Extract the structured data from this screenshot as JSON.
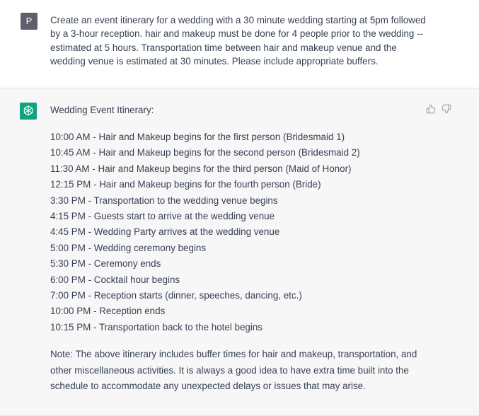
{
  "user_message": {
    "avatar_letter": "P",
    "text": "Create an event itinerary for a wedding with a 30 minute wedding starting at 5pm followed by a 3-hour reception. hair and makeup must be done for 4 people prior to the wedding -- estimated at 5 hours. Transportation time between hair and makeup venue and the wedding venue is estimated at 30 minutes. Please include appropriate buffers."
  },
  "assistant_message": {
    "avatar_icon": "openai-logo-icon",
    "heading": "Wedding Event Itinerary:",
    "itinerary": [
      "10:00 AM - Hair and Makeup begins for the first person (Bridesmaid 1)",
      "10:45 AM - Hair and Makeup begins for the second person (Bridesmaid 2)",
      "11:30 AM - Hair and Makeup begins for the third person (Maid of Honor)",
      "12:15 PM - Hair and Makeup begins for the fourth person (Bride)",
      "3:30 PM - Transportation to the wedding venue begins",
      "4:15 PM - Guests start to arrive at the wedding venue",
      "4:45 PM - Wedding Party arrives at the wedding venue",
      "5:00 PM - Wedding ceremony begins",
      "5:30 PM - Ceremony ends",
      "6:00 PM - Cocktail hour begins",
      "7:00 PM - Reception starts (dinner, speeches, dancing, etc.)",
      "10:00 PM - Reception ends",
      "10:15 PM - Transportation back to the hotel begins"
    ],
    "note": "Note: The above itinerary includes buffer times for hair and makeup, transportation, and other miscellaneous activities. It is always a good idea to have extra time built into the schedule to accommodate any unexpected delays or issues that may arise."
  },
  "feedback": {
    "thumbs_up_icon": "thumbs-up-icon",
    "thumbs_down_icon": "thumbs-down-icon"
  },
  "colors": {
    "assistant_avatar_bg": "#10a37f",
    "user_avatar_bg": "#5e5e6e",
    "assistant_block_bg": "#f7f7f8"
  }
}
